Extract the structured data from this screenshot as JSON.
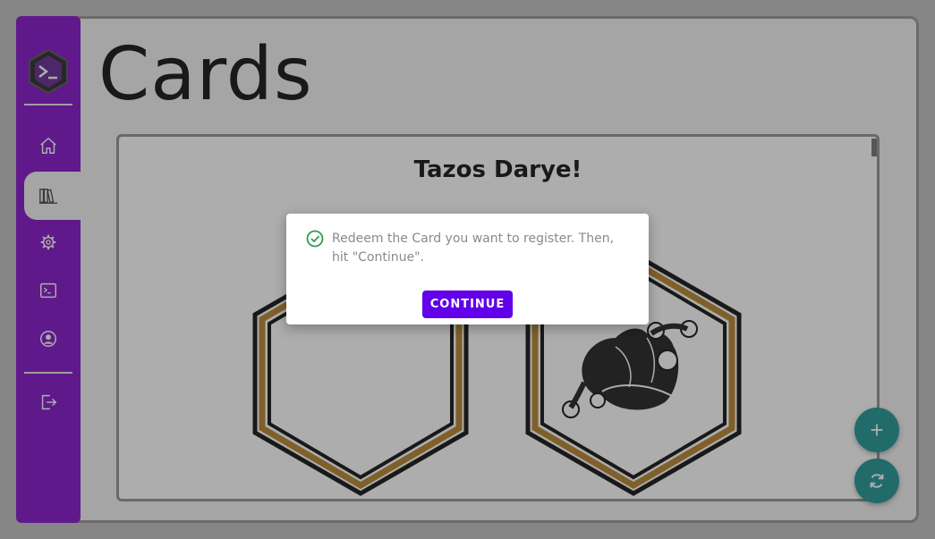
{
  "colors": {
    "sidebar": "#7a00c4",
    "accent_button": "#6200ea",
    "fab": "#0f8d8d",
    "success": "#2e9a52",
    "card_border_gold": "#b07a1e"
  },
  "sidebar": {
    "logo_icon": "terminal-hexagon-logo",
    "items": [
      {
        "name": "home",
        "icon": "home-icon",
        "active": false
      },
      {
        "name": "library",
        "icon": "library-icon",
        "active": true
      },
      {
        "name": "settings",
        "icon": "gear-icon",
        "active": false
      },
      {
        "name": "terminal",
        "icon": "terminal-icon",
        "active": false
      },
      {
        "name": "profile",
        "icon": "account-icon",
        "active": false
      },
      {
        "name": "logout",
        "icon": "logout-icon",
        "active": false
      }
    ]
  },
  "page": {
    "title": "Cards"
  },
  "panel": {
    "title": "Tazos Darye!",
    "cards": [
      {
        "image": "blank-hexagon"
      },
      {
        "image": "jester-hat-hexagon"
      }
    ]
  },
  "fabs": [
    {
      "icon": "plus-icon"
    },
    {
      "icon": "refresh-icon"
    }
  ],
  "dialog": {
    "icon": "check-circle-icon",
    "message": "Redeem the Card you want to register. Then, hit \"Continue\".",
    "button_label": "CONTINUE"
  }
}
